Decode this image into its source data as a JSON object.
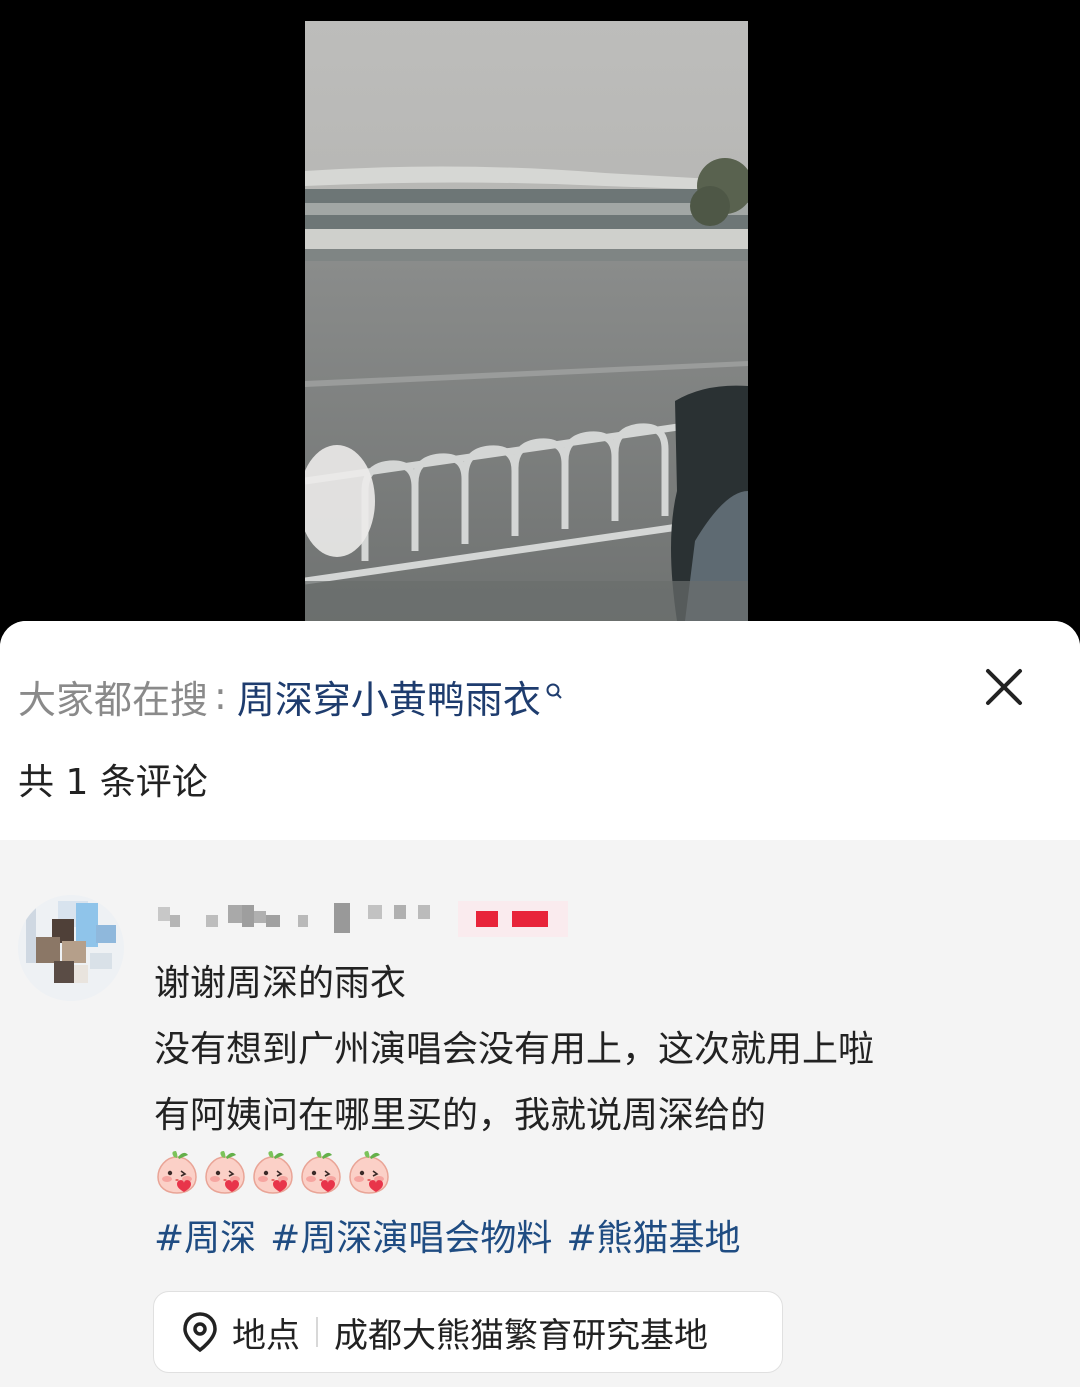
{
  "search": {
    "prefix": "大家都在搜",
    "colon": ":",
    "term": "周深穿小黄鸭雨衣"
  },
  "comments": {
    "count_text": "共 1 条评论"
  },
  "comment": {
    "lines": [
      "谢谢周深的雨衣",
      "没有想到广州演唱会没有用上，这次就用上啦",
      "有阿姨问在哪里买的，我就说周深给的"
    ],
    "emoji_count": 5,
    "tags": [
      "#周深",
      "#周深演唱会物料",
      "#熊猫基地"
    ]
  },
  "location": {
    "label": "地点",
    "name": "成都大熊猫繁育研究基地"
  },
  "colors": {
    "search_term": "#1e3c6e",
    "tag": "#1f4c82",
    "username_badge": "#e8243a"
  },
  "icons": {
    "close": "close-icon",
    "search": "search-icon",
    "location": "location-pin-icon",
    "emoji": "peach-blush-emoji"
  }
}
